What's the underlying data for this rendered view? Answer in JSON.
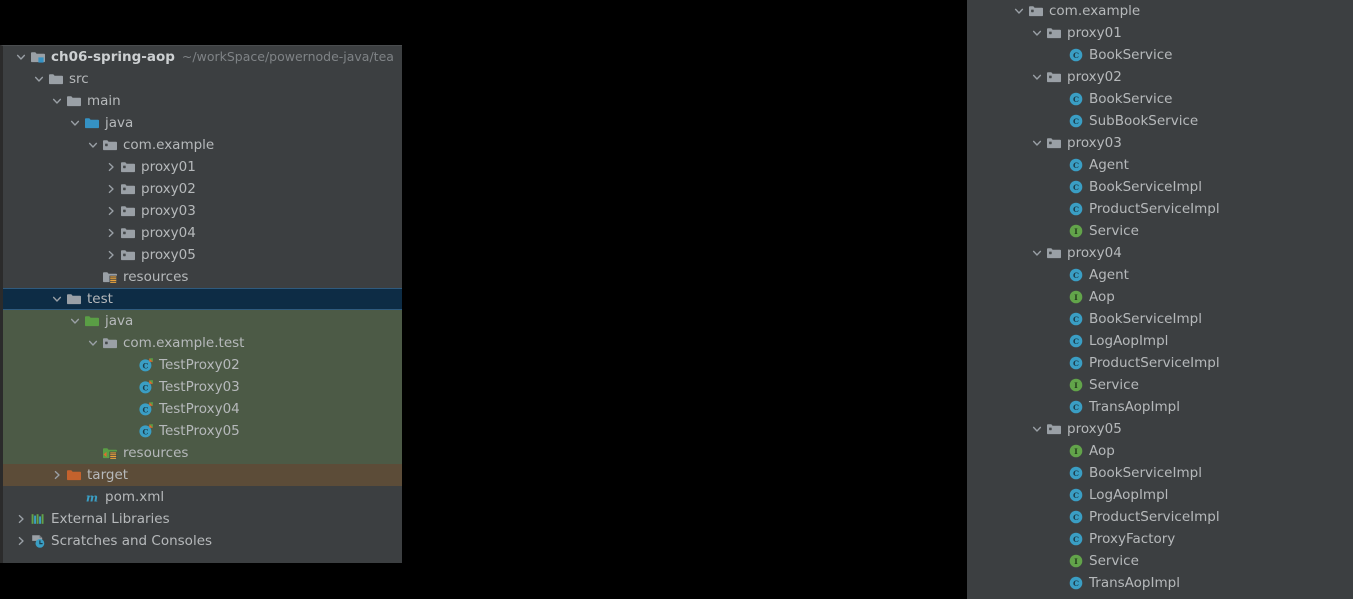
{
  "colors": {
    "panel_bg": "#3c3f41",
    "text": "#b6b9bb",
    "path_text": "#7f8386",
    "selection_bg": "#0d2c45",
    "test_scope_bg": "#4c5a46",
    "target_scope_bg": "#5c4c38",
    "class_icon": "#3a9ec4",
    "interface_icon": "#62a44a",
    "folder_gray": "#9aa0a6",
    "folder_blue": "#3592c4",
    "folder_green": "#62a44a",
    "folder_orange": "#cc6633"
  },
  "project_tree": {
    "name": "Project",
    "rows": [
      {
        "label": "ch06-spring-aop",
        "path": "~/workSpace/powernode-java/tea",
        "icon": "module-folder-icon",
        "arrow": "expanded",
        "indent": 0,
        "bold": true,
        "state": "normal"
      },
      {
        "label": "src",
        "icon": "folder-gray-icon",
        "arrow": "expanded",
        "indent": 1,
        "bold": false,
        "state": "normal"
      },
      {
        "label": "main",
        "icon": "folder-gray-icon",
        "arrow": "expanded",
        "indent": 2,
        "bold": false,
        "state": "normal"
      },
      {
        "label": "java",
        "icon": "source-root-icon",
        "arrow": "expanded",
        "indent": 3,
        "bold": false,
        "state": "normal"
      },
      {
        "label": "com.example",
        "icon": "package-icon",
        "arrow": "expanded",
        "indent": 4,
        "bold": false,
        "state": "normal"
      },
      {
        "label": "proxy01",
        "icon": "package-icon",
        "arrow": "collapsed",
        "indent": 5,
        "bold": false,
        "state": "normal"
      },
      {
        "label": "proxy02",
        "icon": "package-icon",
        "arrow": "collapsed",
        "indent": 5,
        "bold": false,
        "state": "normal"
      },
      {
        "label": "proxy03",
        "icon": "package-icon",
        "arrow": "collapsed",
        "indent": 5,
        "bold": false,
        "state": "normal"
      },
      {
        "label": "proxy04",
        "icon": "package-icon",
        "arrow": "collapsed",
        "indent": 5,
        "bold": false,
        "state": "normal"
      },
      {
        "label": "proxy05",
        "icon": "package-icon",
        "arrow": "collapsed",
        "indent": 5,
        "bold": false,
        "state": "normal"
      },
      {
        "label": "resources",
        "icon": "resource-root-icon",
        "arrow": "none",
        "indent": 4,
        "bold": false,
        "state": "normal"
      },
      {
        "label": "test",
        "icon": "folder-gray-icon",
        "arrow": "expanded",
        "indent": 2,
        "bold": false,
        "state": "selected"
      },
      {
        "label": "java",
        "icon": "test-source-root-icon",
        "arrow": "expanded",
        "indent": 3,
        "bold": false,
        "state": "test-scope"
      },
      {
        "label": "com.example.test",
        "icon": "package-icon",
        "arrow": "expanded",
        "indent": 4,
        "bold": false,
        "state": "test-scope"
      },
      {
        "label": "TestProxy02",
        "icon": "runnable-class-icon",
        "arrow": "none",
        "indent": 6,
        "bold": false,
        "state": "test-scope"
      },
      {
        "label": "TestProxy03",
        "icon": "runnable-class-icon",
        "arrow": "none",
        "indent": 6,
        "bold": false,
        "state": "test-scope"
      },
      {
        "label": "TestProxy04",
        "icon": "runnable-class-icon",
        "arrow": "none",
        "indent": 6,
        "bold": false,
        "state": "test-scope"
      },
      {
        "label": "TestProxy05",
        "icon": "runnable-class-icon",
        "arrow": "none",
        "indent": 6,
        "bold": false,
        "state": "test-scope"
      },
      {
        "label": "resources",
        "icon": "test-resource-root-icon",
        "arrow": "none",
        "indent": 4,
        "bold": false,
        "state": "test-scope"
      },
      {
        "label": "target",
        "icon": "excluded-folder-icon",
        "arrow": "collapsed",
        "indent": 2,
        "bold": false,
        "state": "target-scope"
      },
      {
        "label": "pom.xml",
        "icon": "maven-file-icon",
        "arrow": "none",
        "indent": 3,
        "bold": false,
        "state": "normal"
      },
      {
        "label": "External Libraries",
        "icon": "libraries-icon",
        "arrow": "collapsed",
        "indent": 0,
        "bold": false,
        "state": "normal"
      },
      {
        "label": "Scratches and Consoles",
        "icon": "scratches-icon",
        "arrow": "collapsed",
        "indent": 0,
        "bold": false,
        "state": "normal"
      }
    ]
  },
  "structure_tree": {
    "name": "Packages",
    "rows": [
      {
        "label": "com.example",
        "icon": "package-icon",
        "arrow": "expanded",
        "indent": 0
      },
      {
        "label": "proxy01",
        "icon": "package-icon",
        "arrow": "expanded",
        "indent": 1
      },
      {
        "label": "BookService",
        "icon": "class-icon",
        "arrow": "none",
        "indent": 2
      },
      {
        "label": "proxy02",
        "icon": "package-icon",
        "arrow": "expanded",
        "indent": 1
      },
      {
        "label": "BookService",
        "icon": "class-icon",
        "arrow": "none",
        "indent": 2
      },
      {
        "label": "SubBookService",
        "icon": "class-icon",
        "arrow": "none",
        "indent": 2
      },
      {
        "label": "proxy03",
        "icon": "package-icon",
        "arrow": "expanded",
        "indent": 1
      },
      {
        "label": "Agent",
        "icon": "class-icon",
        "arrow": "none",
        "indent": 2
      },
      {
        "label": "BookServiceImpl",
        "icon": "class-icon",
        "arrow": "none",
        "indent": 2
      },
      {
        "label": "ProductServiceImpl",
        "icon": "class-icon",
        "arrow": "none",
        "indent": 2
      },
      {
        "label": "Service",
        "icon": "interface-icon",
        "arrow": "none",
        "indent": 2
      },
      {
        "label": "proxy04",
        "icon": "package-icon",
        "arrow": "expanded",
        "indent": 1
      },
      {
        "label": "Agent",
        "icon": "class-icon",
        "arrow": "none",
        "indent": 2
      },
      {
        "label": "Aop",
        "icon": "interface-icon",
        "arrow": "none",
        "indent": 2
      },
      {
        "label": "BookServiceImpl",
        "icon": "class-icon",
        "arrow": "none",
        "indent": 2
      },
      {
        "label": "LogAopImpl",
        "icon": "class-icon",
        "arrow": "none",
        "indent": 2
      },
      {
        "label": "ProductServiceImpl",
        "icon": "class-icon",
        "arrow": "none",
        "indent": 2
      },
      {
        "label": "Service",
        "icon": "interface-icon",
        "arrow": "none",
        "indent": 2
      },
      {
        "label": "TransAopImpl",
        "icon": "class-icon",
        "arrow": "none",
        "indent": 2
      },
      {
        "label": "proxy05",
        "icon": "package-icon",
        "arrow": "expanded",
        "indent": 1
      },
      {
        "label": "Aop",
        "icon": "interface-icon",
        "arrow": "none",
        "indent": 2
      },
      {
        "label": "BookServiceImpl",
        "icon": "class-icon",
        "arrow": "none",
        "indent": 2
      },
      {
        "label": "LogAopImpl",
        "icon": "class-icon",
        "arrow": "none",
        "indent": 2
      },
      {
        "label": "ProductServiceImpl",
        "icon": "class-icon",
        "arrow": "none",
        "indent": 2
      },
      {
        "label": "ProxyFactory",
        "icon": "class-icon",
        "arrow": "none",
        "indent": 2
      },
      {
        "label": "Service",
        "icon": "interface-icon",
        "arrow": "none",
        "indent": 2
      },
      {
        "label": "TransAopImpl",
        "icon": "class-icon",
        "arrow": "none",
        "indent": 2
      }
    ]
  }
}
